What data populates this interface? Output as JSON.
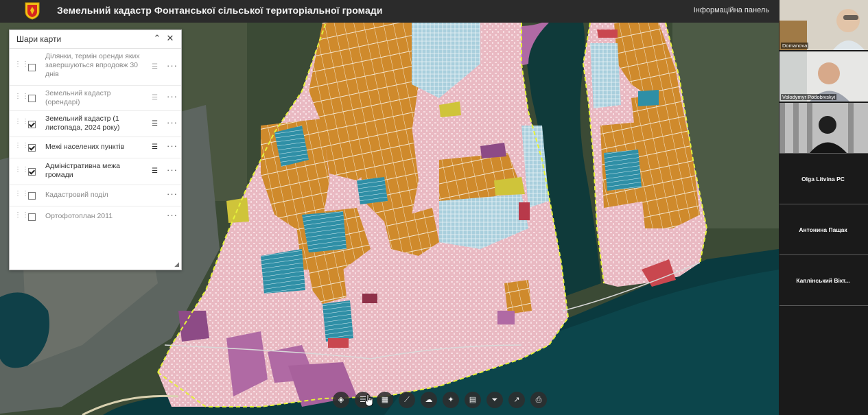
{
  "header": {
    "title": "Земельний кадастр Фонтанської сільської територіальної громади",
    "info_panel_label": "Інформаційна панель",
    "logo_icon": "coat-of-arms-icon"
  },
  "layers_panel": {
    "title": "Шари карти",
    "layers": [
      {
        "label": "Ділянки, термін оренди яких завершуються впродовж 30 днів",
        "checked": false
      },
      {
        "label": "Земельний кадастр (орендарі)",
        "checked": false
      },
      {
        "label": "Земельний кадастр (1 листопада, 2024 року)",
        "checked": true
      },
      {
        "label": "Межі населених пунктів",
        "checked": true
      },
      {
        "label": "Адміністративна межа громади",
        "checked": true
      },
      {
        "label": "Кадастровий поділ",
        "checked": false
      },
      {
        "label": "Ортофотоплан 2011",
        "checked": false
      }
    ]
  },
  "video_participants": [
    {
      "name": "Domanova",
      "type": "video"
    },
    {
      "name": "Volodymyr Podobivskyi",
      "type": "video"
    },
    {
      "name": "",
      "type": "video"
    },
    {
      "name": "Olga Litvina PC",
      "type": "name-only"
    },
    {
      "name": "Антонина Пащак",
      "type": "name-only"
    },
    {
      "name": "Каплінський Вікт...",
      "type": "name-only"
    }
  ],
  "map_toolbar": {
    "tools": [
      "layers-icon",
      "legend-icon",
      "basemap-gallery-icon",
      "measure-icon",
      "bookmarks-icon",
      "analysis-icon",
      "print-preview-icon",
      "filter-icon",
      "share-icon",
      "print-icon"
    ]
  },
  "colors": {
    "topbar": "#2b2b2b",
    "parcel_orange": "#cf8a2c",
    "parcel_blue": "#2f8fa6",
    "parcel_pink": "#f2c9cf",
    "parcel_magenta": "#b06aa4",
    "parcel_yellow": "#cfc43a",
    "boundary_dash": "#e5f23a",
    "water": "#0f3a3a",
    "sea": "#0a3a3f"
  }
}
